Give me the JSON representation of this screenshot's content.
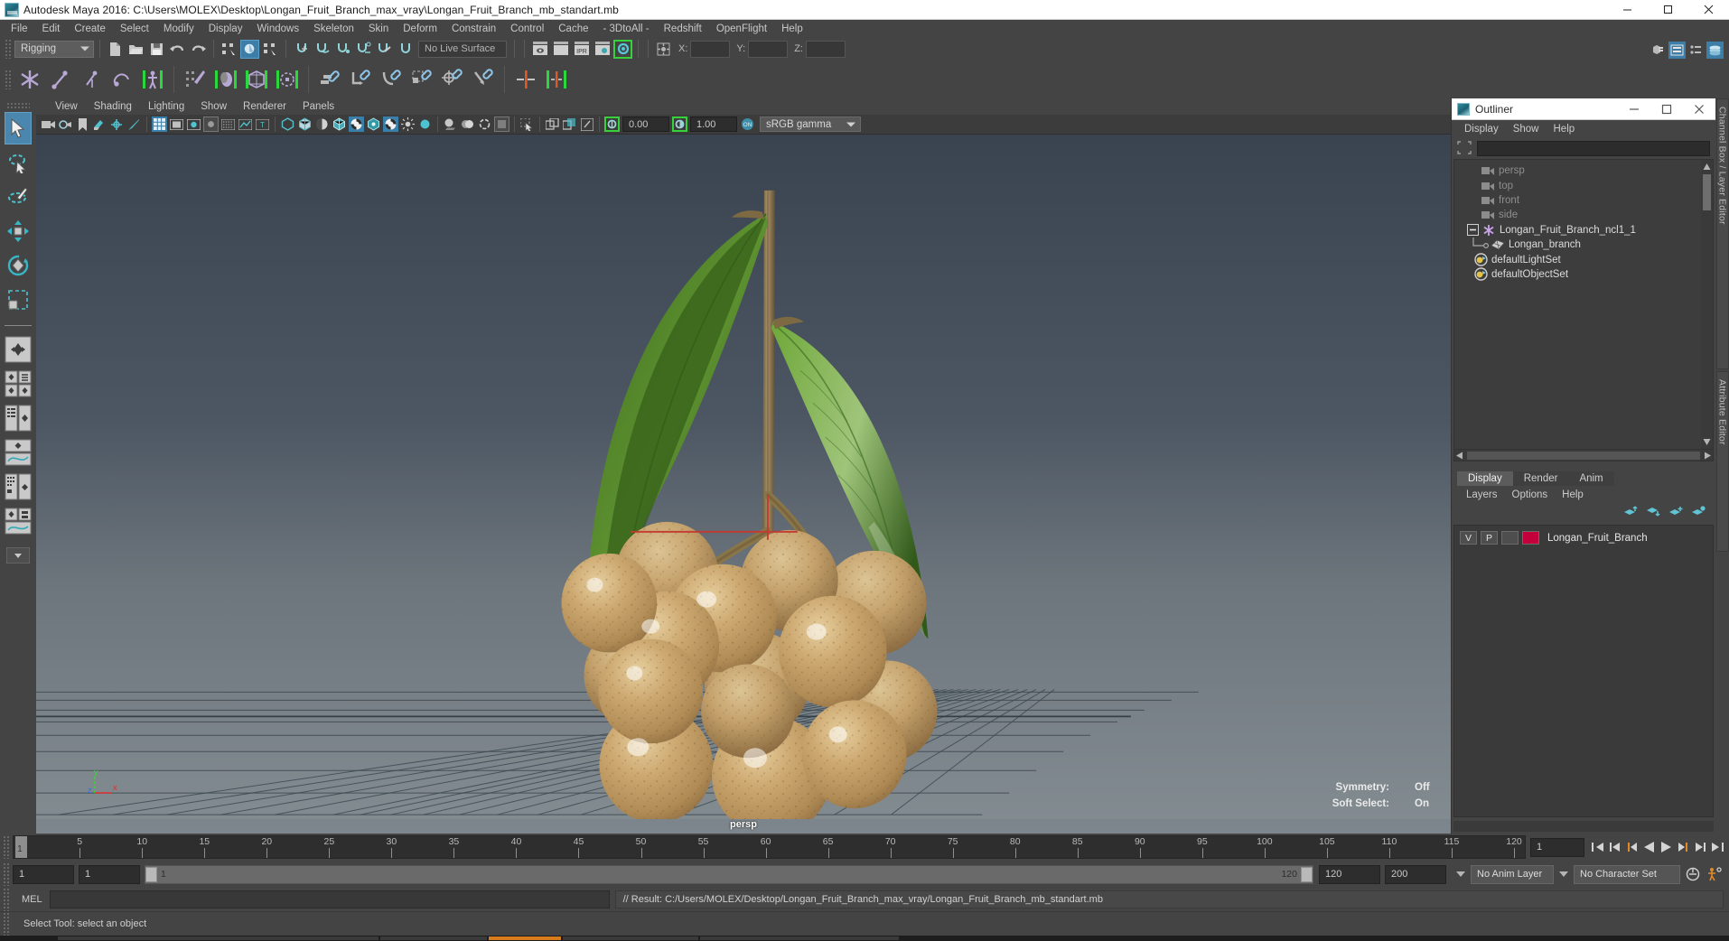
{
  "window": {
    "title": "Autodesk Maya 2016: C:\\Users\\MOLEX\\Desktop\\Longan_Fruit_Branch_max_vray\\Longan_Fruit_Branch_mb_standart.mb",
    "minimize": "—",
    "maximize": "☐",
    "close": "✕"
  },
  "menubar": {
    "items": [
      "File",
      "Edit",
      "Create",
      "Select",
      "Modify",
      "Display",
      "Windows",
      "Skeleton",
      "Skin",
      "Deform",
      "Constrain",
      "Control",
      "Cache",
      "- 3DtoAll -",
      "Redshift",
      "OpenFlight",
      "Help"
    ]
  },
  "statusline": {
    "menu_set": "Rigging",
    "live_surface": "No Live Surface",
    "axis_x_label": "X:",
    "axis_y_label": "Y:",
    "axis_z_label": "Z:",
    "axis_x_value": "",
    "axis_y_value": "",
    "axis_z_value": ""
  },
  "viewport_menu": {
    "items": [
      "View",
      "Shading",
      "Lighting",
      "Show",
      "Renderer",
      "Panels"
    ]
  },
  "viewport_toolbar": {
    "exposure_value": "0.00",
    "gamma_value": "1.00",
    "color_profile": "sRGB gamma"
  },
  "viewport": {
    "camera_label": "persp",
    "axis_x": "x",
    "axis_y": "y",
    "axis_z": "z",
    "hud": [
      {
        "key": "Symmetry:",
        "value": "Off"
      },
      {
        "key": "Soft Select:",
        "value": "On"
      }
    ]
  },
  "outliner": {
    "title": "Outliner",
    "menu": [
      "Display",
      "Show",
      "Help"
    ],
    "search_value": "",
    "items": [
      {
        "label": "persp",
        "type": "camera",
        "indent": 1,
        "dim": true
      },
      {
        "label": "top",
        "type": "camera",
        "indent": 1,
        "dim": true
      },
      {
        "label": "front",
        "type": "camera",
        "indent": 1,
        "dim": true
      },
      {
        "label": "side",
        "type": "camera",
        "indent": 1,
        "dim": true
      },
      {
        "label": "Longan_Fruit_Branch_ncl1_1",
        "type": "nucleus",
        "indent": 0,
        "dim": false,
        "expanded": true
      },
      {
        "label": "Longan_branch",
        "type": "mesh",
        "indent": 2,
        "dim": false
      },
      {
        "label": "defaultLightSet",
        "type": "set",
        "indent": 1,
        "dim": false
      },
      {
        "label": "defaultObjectSet",
        "type": "set",
        "indent": 1,
        "dim": false
      }
    ]
  },
  "layer_editor": {
    "tabs": [
      {
        "label": "Display",
        "active": true
      },
      {
        "label": "Render",
        "active": false
      },
      {
        "label": "Anim",
        "active": false
      }
    ],
    "menu": [
      "Layers",
      "Options",
      "Help"
    ],
    "layers": [
      {
        "visibility": "V",
        "playback": "P",
        "shading": "",
        "color": "#c4003c",
        "name": "Longan_Fruit_Branch"
      }
    ]
  },
  "side_tabs": [
    "Channel Box / Layer Editor",
    "Attribute Editor"
  ],
  "timeslider": {
    "current_frame": "1",
    "ticks": [
      5,
      10,
      15,
      20,
      25,
      30,
      35,
      40,
      45,
      50,
      55,
      60,
      65,
      70,
      75,
      80,
      85,
      90,
      95,
      100,
      105,
      110,
      115,
      120
    ],
    "start": 1,
    "end": 120,
    "frame_field": "1"
  },
  "range_slider": {
    "anim_start": "1",
    "playback_start": "1",
    "range_start_label": "1",
    "range_end_label": "120",
    "playback_end": "120",
    "anim_end": "200",
    "anim_layer": "No Anim Layer",
    "character_set": "No Character Set"
  },
  "command_line": {
    "label": "MEL",
    "input_value": "",
    "result": "// Result: C:/Users/MOLEX/Desktop/Longan_Fruit_Branch_max_vray/Longan_Fruit_Branch_mb_standart.mb"
  },
  "help_line": {
    "text": "Select Tool: select an object"
  },
  "icons": {
    "select_tool": "arrow-cursor-icon",
    "lasso_tool": "lasso-select-icon",
    "paint_select": "paint-select-icon",
    "move_tool": "move-tool-icon",
    "rotate_tool": "rotate-tool-icon",
    "scale_tool": "scale-tool-icon"
  }
}
